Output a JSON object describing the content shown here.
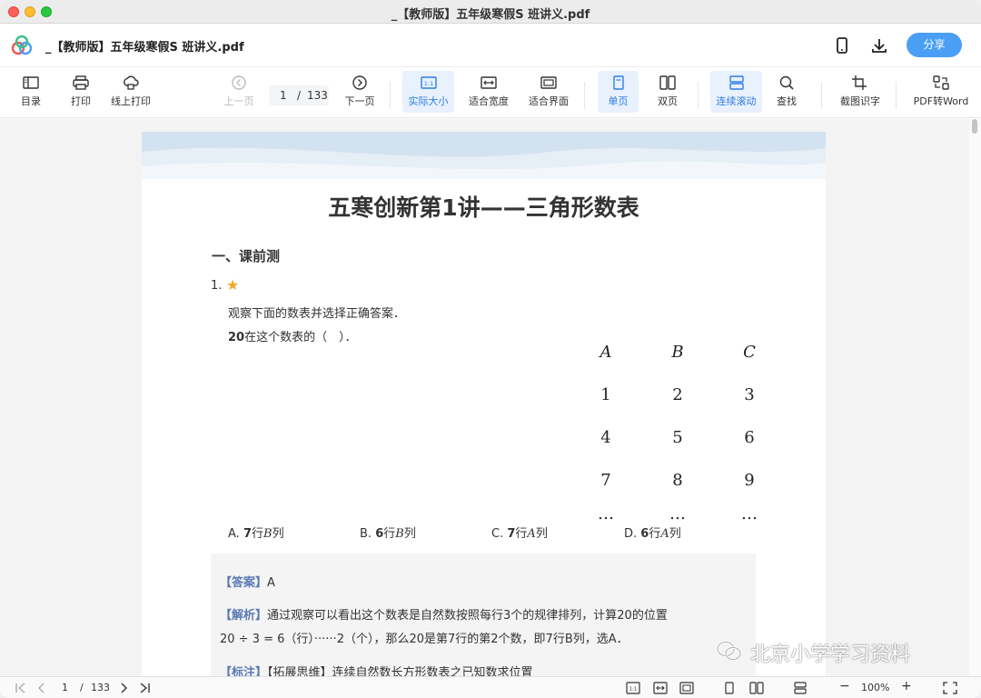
{
  "window": {
    "title": "_【教师版】五年级寒假S 班讲义.pdf"
  },
  "header": {
    "doc_title": "_【教师版】五年级寒假S 班讲义.pdf",
    "share_label": "分享"
  },
  "toolbar": {
    "toc": "目录",
    "print": "打印",
    "online_print": "线上打印",
    "prev_page": "上一页",
    "page_current": "1",
    "page_sep": "/",
    "page_total": "133",
    "next_page": "下一页",
    "actual_size": "实际大小",
    "fit_width": "适合宽度",
    "fit_page": "适合界面",
    "single_page": "单页",
    "double_page": "双页",
    "continuous_scroll": "连续滚动",
    "find": "查找",
    "screenshot_ocr": "截图识字",
    "pdf_to_word": "PDF转Word"
  },
  "document": {
    "title": "五寒创新第1讲——三角形数表",
    "section": "一、课前测",
    "question": {
      "number": "1.",
      "star": "★",
      "line1": "观察下面的数表并选择正确答案．",
      "line2_bold": "20",
      "line2_rest": "在这个数表的（　）．",
      "grid_headers": [
        "A",
        "B",
        "C"
      ],
      "grid_rows": [
        [
          "1",
          "2",
          "3"
        ],
        [
          "4",
          "5",
          "6"
        ],
        [
          "7",
          "8",
          "9"
        ],
        [
          "…",
          "…",
          "…"
        ]
      ],
      "options": [
        {
          "letter": "A.",
          "row": "7",
          "row_unit": "行",
          "col": "B",
          "col_unit": "列"
        },
        {
          "letter": "B.",
          "row": "6",
          "row_unit": "行",
          "col": "B",
          "col_unit": "列"
        },
        {
          "letter": "C.",
          "row": "7",
          "row_unit": "行",
          "col": "A",
          "col_unit": "列"
        },
        {
          "letter": "D.",
          "row": "6",
          "row_unit": "行",
          "col": "A",
          "col_unit": "列"
        }
      ]
    },
    "answer": {
      "answer_tag": "【答案】",
      "answer_value": "A",
      "analysis_tag": "【解析】",
      "analysis_line1": "通过观察可以看出这个数表是自然数按照每行3个的规律排列，计算20的位置",
      "analysis_line2": "20 ÷ 3 = 6（行）······2（个），那么20是第7行的第2个数，即7行B列，选A．",
      "note_tag": "【标注】",
      "note_text": "【拓展思维】连续自然数长方形数表之已知数求位置"
    }
  },
  "watermark": "北京小学学习资料",
  "statusbar": {
    "page_current": "1",
    "page_sep": "/",
    "page_total": "133",
    "zoom": "100%",
    "zoom_minus": "−",
    "zoom_plus": "+"
  }
}
